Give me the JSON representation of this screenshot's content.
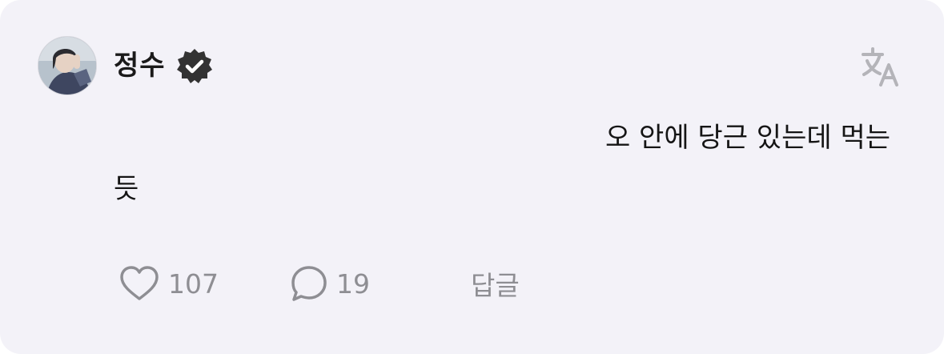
{
  "post": {
    "author": "정수",
    "verified_icon": "verified-badge-icon",
    "translate_icon": "translate-icon",
    "text_line1": "오 안에 당근 있는데 먹는",
    "text_line2": "듯"
  },
  "actions": {
    "like_icon": "heart-icon",
    "like_count": "107",
    "comment_icon": "comment-bubble-icon",
    "comment_count": "19",
    "reply_label": "답글"
  },
  "colors": {
    "card_bg": "#f3f2f8",
    "text": "#151515",
    "muted": "#8e8e93"
  }
}
